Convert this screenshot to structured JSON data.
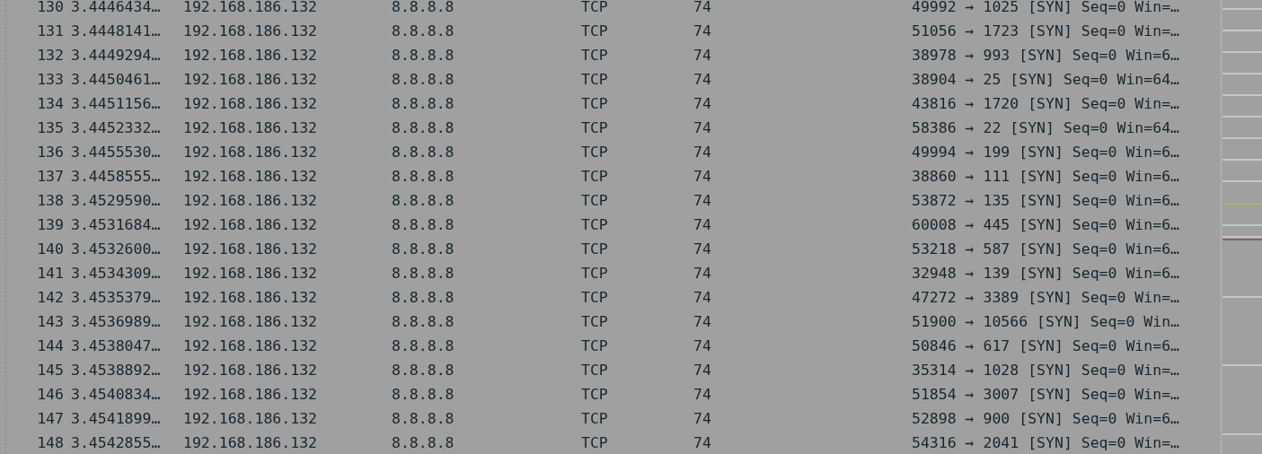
{
  "packets": [
    {
      "number": "130",
      "time": "3.4446434…",
      "source": "192.168.186.132",
      "destination": "8.8.8.8",
      "protocol": "TCP",
      "length": "74",
      "info": "49992 → 1025 [SYN] Seq=0 Win=…"
    },
    {
      "number": "131",
      "time": "3.4448141…",
      "source": "192.168.186.132",
      "destination": "8.8.8.8",
      "protocol": "TCP",
      "length": "74",
      "info": "51056 → 1723 [SYN] Seq=0 Win=…"
    },
    {
      "number": "132",
      "time": "3.4449294…",
      "source": "192.168.186.132",
      "destination": "8.8.8.8",
      "protocol": "TCP",
      "length": "74",
      "info": "38978 → 993 [SYN] Seq=0 Win=6…"
    },
    {
      "number": "133",
      "time": "3.4450461…",
      "source": "192.168.186.132",
      "destination": "8.8.8.8",
      "protocol": "TCP",
      "length": "74",
      "info": "38904 → 25 [SYN] Seq=0 Win=64…"
    },
    {
      "number": "134",
      "time": "3.4451156…",
      "source": "192.168.186.132",
      "destination": "8.8.8.8",
      "protocol": "TCP",
      "length": "74",
      "info": "43816 → 1720 [SYN] Seq=0 Win=…"
    },
    {
      "number": "135",
      "time": "3.4452332…",
      "source": "192.168.186.132",
      "destination": "8.8.8.8",
      "protocol": "TCP",
      "length": "74",
      "info": "58386 → 22 [SYN] Seq=0 Win=64…"
    },
    {
      "number": "136",
      "time": "3.4455530…",
      "source": "192.168.186.132",
      "destination": "8.8.8.8",
      "protocol": "TCP",
      "length": "74",
      "info": "49994 → 199 [SYN] Seq=0 Win=6…"
    },
    {
      "number": "137",
      "time": "3.4458555…",
      "source": "192.168.186.132",
      "destination": "8.8.8.8",
      "protocol": "TCP",
      "length": "74",
      "info": "38860 → 111 [SYN] Seq=0 Win=6…"
    },
    {
      "number": "138",
      "time": "3.4529590…",
      "source": "192.168.186.132",
      "destination": "8.8.8.8",
      "protocol": "TCP",
      "length": "74",
      "info": "53872 → 135 [SYN] Seq=0 Win=6…"
    },
    {
      "number": "139",
      "time": "3.4531684…",
      "source": "192.168.186.132",
      "destination": "8.8.8.8",
      "protocol": "TCP",
      "length": "74",
      "info": "60008 → 445 [SYN] Seq=0 Win=6…"
    },
    {
      "number": "140",
      "time": "3.4532600…",
      "source": "192.168.186.132",
      "destination": "8.8.8.8",
      "protocol": "TCP",
      "length": "74",
      "info": "53218 → 587 [SYN] Seq=0 Win=6…"
    },
    {
      "number": "141",
      "time": "3.4534309…",
      "source": "192.168.186.132",
      "destination": "8.8.8.8",
      "protocol": "TCP",
      "length": "74",
      "info": "32948 → 139 [SYN] Seq=0 Win=6…"
    },
    {
      "number": "142",
      "time": "3.4535379…",
      "source": "192.168.186.132",
      "destination": "8.8.8.8",
      "protocol": "TCP",
      "length": "74",
      "info": "47272 → 3389 [SYN] Seq=0 Win=…"
    },
    {
      "number": "143",
      "time": "3.4536989…",
      "source": "192.168.186.132",
      "destination": "8.8.8.8",
      "protocol": "TCP",
      "length": "74",
      "info": "51900 → 10566 [SYN] Seq=0 Win…"
    },
    {
      "number": "144",
      "time": "3.4538047…",
      "source": "192.168.186.132",
      "destination": "8.8.8.8",
      "protocol": "TCP",
      "length": "74",
      "info": "50846 → 617 [SYN] Seq=0 Win=6…"
    },
    {
      "number": "145",
      "time": "3.4538892…",
      "source": "192.168.186.132",
      "destination": "8.8.8.8",
      "protocol": "TCP",
      "length": "74",
      "info": "35314 → 1028 [SYN] Seq=0 Win=…"
    },
    {
      "number": "146",
      "time": "3.4540834…",
      "source": "192.168.186.132",
      "destination": "8.8.8.8",
      "protocol": "TCP",
      "length": "74",
      "info": "51854 → 3007 [SYN] Seq=0 Win=…"
    },
    {
      "number": "147",
      "time": "3.4541899…",
      "source": "192.168.186.132",
      "destination": "8.8.8.8",
      "protocol": "TCP",
      "length": "74",
      "info": "52898 → 900 [SYN] Seq=0 Win=6…"
    },
    {
      "number": "148",
      "time": "3.4542855…",
      "source": "192.168.186.132",
      "destination": "8.8.8.8",
      "protocol": "TCP",
      "length": "74",
      "info": "54316 → 2041 [SYN] Seq=0 Win=…"
    }
  ]
}
